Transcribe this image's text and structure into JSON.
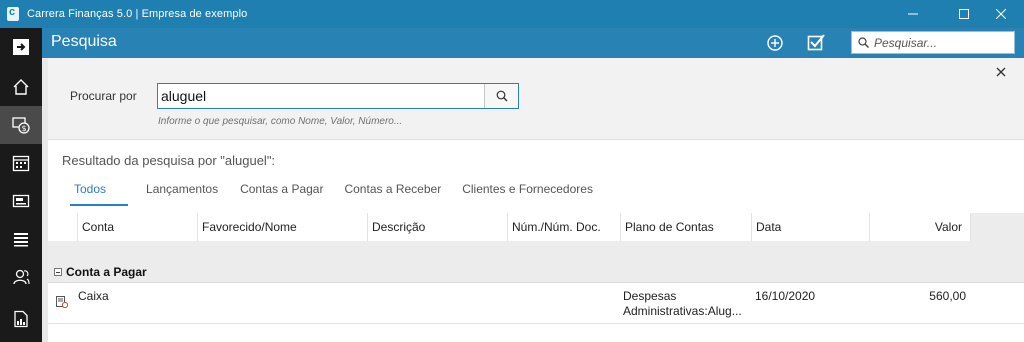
{
  "window": {
    "title": "Carrera Finanças 5.0 | Empresa de exemplo"
  },
  "header": {
    "title": "Pesquisa",
    "search_placeholder": "Pesquisar..."
  },
  "sidebar": {
    "items": [
      {
        "name": "exit",
        "icon": "exit-icon"
      },
      {
        "name": "home",
        "icon": "home-icon"
      },
      {
        "name": "finance",
        "icon": "money-icon",
        "active": true
      },
      {
        "name": "calendar",
        "icon": "calendar-icon"
      },
      {
        "name": "cards",
        "icon": "card-icon"
      },
      {
        "name": "reports",
        "icon": "list-icon"
      },
      {
        "name": "contacts",
        "icon": "people-icon"
      },
      {
        "name": "charts",
        "icon": "chart-doc-icon"
      }
    ]
  },
  "search": {
    "label": "Procurar por",
    "value": "aluguel",
    "hint": "Informe o que pesquisar, como Nome, Valor, Número..."
  },
  "results": {
    "title": "Resultado da pesquisa por \"aluguel\":",
    "tabs": [
      {
        "label": "Todos",
        "active": true
      },
      {
        "label": "Lançamentos"
      },
      {
        "label": "Contas a Pagar"
      },
      {
        "label": "Contas a Receber"
      },
      {
        "label": "Clientes e Fornecedores"
      }
    ],
    "columns": [
      "Conta",
      "Favorecido/Nome",
      "Descrição",
      "Núm./Núm. Doc.",
      "Plano de Contas",
      "Data",
      "Valor"
    ],
    "groups": [
      {
        "label": "Conta a Pagar",
        "rows": [
          {
            "conta": "Caixa",
            "favorecido": "",
            "descricao": "",
            "numero": "",
            "plano_line1": "Despesas",
            "plano_line2": "Administrativas:Alug...",
            "data": "16/10/2020",
            "valor": "560,00"
          }
        ]
      }
    ]
  },
  "colors": {
    "titlebar": "#1f7fb0",
    "header": "#2882b4",
    "sidebar": "#1a1a1a",
    "accent": "#2a7fbf"
  }
}
